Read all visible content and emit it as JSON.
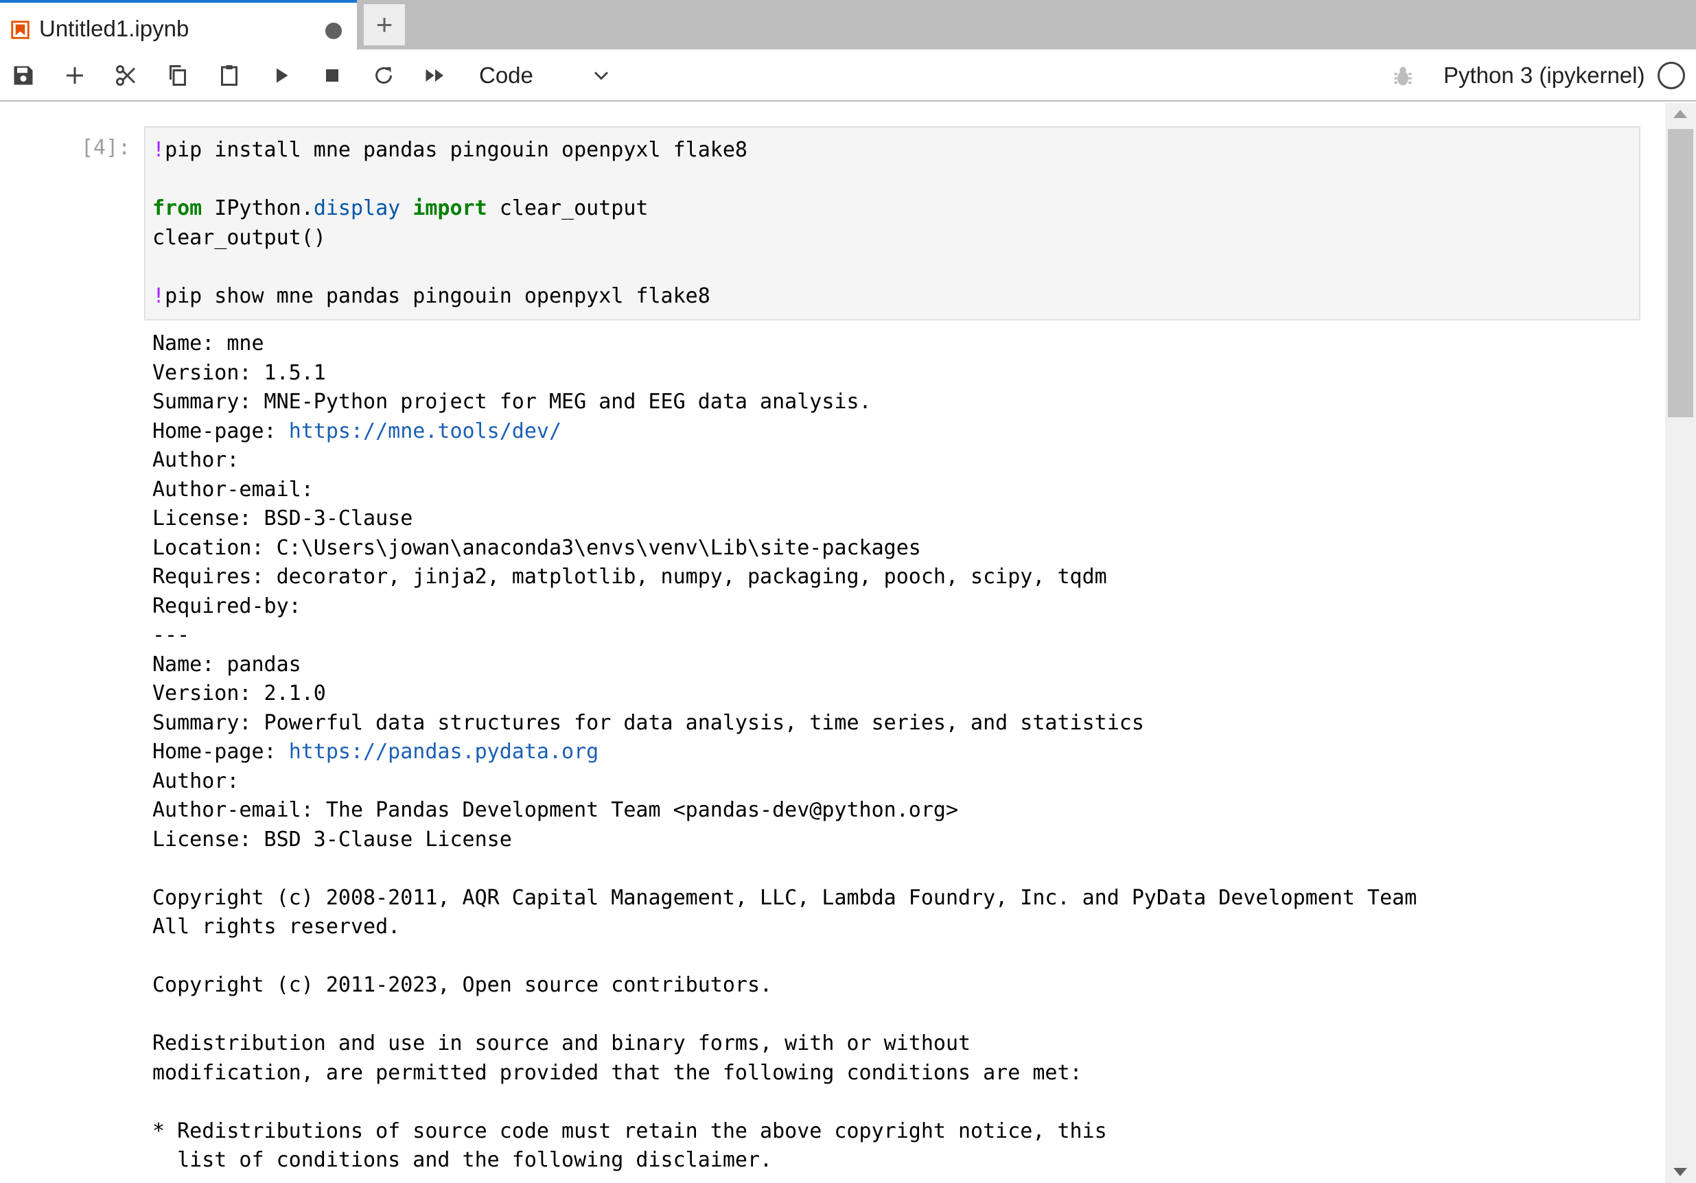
{
  "tab": {
    "title": "Untitled1.ipynb",
    "icon": "notebook-icon",
    "unsaved_indicator": "dirty-dot-icon",
    "new_tab_label": "+"
  },
  "toolbar": {
    "buttons": [
      "save-icon",
      "add-cell-icon",
      "cut-icon",
      "copy-icon",
      "paste-icon",
      "run-icon",
      "interrupt-icon",
      "restart-icon",
      "run-all-icon"
    ],
    "cell_type": "Code",
    "kernel_name": "Python 3 (ipykernel)",
    "kernel_status": "idle"
  },
  "cell": {
    "prompt": "[4]:",
    "code_lines": [
      [
        {
          "t": "!",
          "c": "bang"
        },
        {
          "t": "pip install mne pandas pingouin openpyxl flake8",
          "c": ""
        }
      ],
      [],
      [
        {
          "t": "from",
          "c": "kw"
        },
        {
          "t": " IPython.",
          "c": ""
        },
        {
          "t": "display",
          "c": "mod"
        },
        {
          "t": " ",
          "c": ""
        },
        {
          "t": "import",
          "c": "kw"
        },
        {
          "t": " clear_output",
          "c": ""
        }
      ],
      [
        {
          "t": "clear_output()",
          "c": ""
        }
      ],
      [],
      [
        {
          "t": "!",
          "c": "bang"
        },
        {
          "t": "pip show mne pandas pingouin openpyxl flake8",
          "c": ""
        }
      ]
    ],
    "output_lines": [
      [
        {
          "t": "Name: mne"
        }
      ],
      [
        {
          "t": "Version: 1.5.1"
        }
      ],
      [
        {
          "t": "Summary: MNE-Python project for MEG and EEG data analysis."
        }
      ],
      [
        {
          "t": "Home-page: "
        },
        {
          "t": "https://mne.tools/dev/",
          "link": true
        }
      ],
      [
        {
          "t": "Author: "
        }
      ],
      [
        {
          "t": "Author-email: "
        }
      ],
      [
        {
          "t": "License: BSD-3-Clause"
        }
      ],
      [
        {
          "t": "Location: C:\\Users\\jowan\\anaconda3\\envs\\venv\\Lib\\site-packages"
        }
      ],
      [
        {
          "t": "Requires: decorator, jinja2, matplotlib, numpy, packaging, pooch, scipy, tqdm"
        }
      ],
      [
        {
          "t": "Required-by: "
        }
      ],
      [
        {
          "t": "---"
        }
      ],
      [
        {
          "t": "Name: pandas"
        }
      ],
      [
        {
          "t": "Version: 2.1.0"
        }
      ],
      [
        {
          "t": "Summary: Powerful data structures for data analysis, time series, and statistics"
        }
      ],
      [
        {
          "t": "Home-page: "
        },
        {
          "t": "https://pandas.pydata.org",
          "link": true
        }
      ],
      [
        {
          "t": "Author: "
        }
      ],
      [
        {
          "t": "Author-email: The Pandas Development Team <pandas-dev@python.org>"
        }
      ],
      [
        {
          "t": "License: BSD 3-Clause License"
        }
      ],
      [],
      [
        {
          "t": "Copyright (c) 2008-2011, AQR Capital Management, LLC, Lambda Foundry, Inc. and PyData Development Team"
        }
      ],
      [
        {
          "t": "All rights reserved."
        }
      ],
      [],
      [
        {
          "t": "Copyright (c) 2011-2023, Open source contributors."
        }
      ],
      [],
      [
        {
          "t": "Redistribution and use in source and binary forms, with or without"
        }
      ],
      [
        {
          "t": "modification, are permitted provided that the following conditions are met:"
        }
      ],
      [],
      [
        {
          "t": "* Redistributions of source code must retain the above copyright notice, this"
        }
      ],
      [
        {
          "t": "  list of conditions and the following disclaimer."
        }
      ]
    ]
  },
  "colors": {
    "accent": "#1976d2",
    "keyword": "#008000",
    "magic": "#aa22ff",
    "module": "#0055aa",
    "link": "#1a5fb4",
    "notebook_icon": "#e65100"
  }
}
